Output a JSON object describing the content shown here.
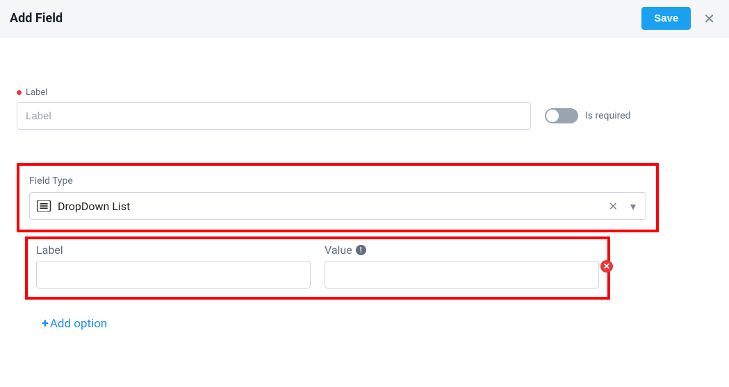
{
  "header": {
    "title": "Add Field",
    "save_label": "Save"
  },
  "label_section": {
    "label_text": "Label",
    "placeholder": "Label",
    "toggle_label": "Is required"
  },
  "field_type": {
    "label": "Field Type",
    "selected": "DropDown List"
  },
  "options": {
    "col_label": "Label",
    "col_value": "Value",
    "row": {
      "label_value": "",
      "value_value": ""
    }
  },
  "add_option_label": "Add option"
}
